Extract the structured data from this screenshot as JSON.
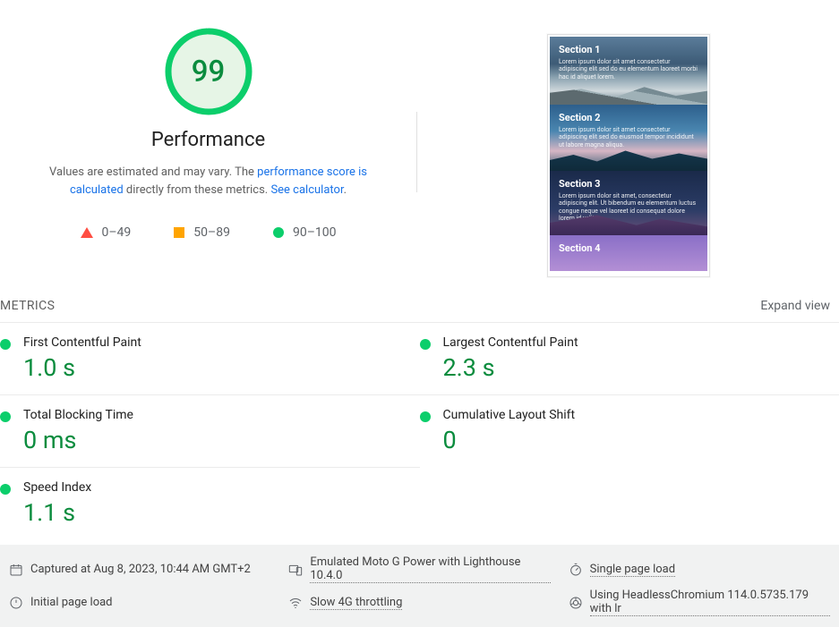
{
  "score": {
    "value": "99",
    "percent": 99,
    "title": "Performance",
    "desc_prefix": "Values are estimated and may vary. The ",
    "link1_text": "performance score is calculated",
    "desc_middle": " directly from these metrics. ",
    "link2_text": "See calculator"
  },
  "legend": {
    "fail": "0–49",
    "avg": "50–89",
    "pass": "90–100"
  },
  "preview_sections": [
    {
      "title": "Section 1",
      "body": "Lorem ipsum dolor sit amet consectetur adipiscing elit sed do eu elementum laoreet morbi hac id aliquet lorem."
    },
    {
      "title": "Section 2",
      "body": "Lorem ipsum dolor sit amet consectetur adipiscing elit sed do eiusmod tempor incididunt ut labore magna aliqua."
    },
    {
      "title": "Section 3",
      "body": "Lorem ipsum dolor sit amet, consectetur adipiscing elit. Ut bibendum eu elementum luctus congue neque vel laoreet id consequat dolore lorem id velit."
    },
    {
      "title": "Section 4",
      "body": ""
    }
  ],
  "metrics_header": {
    "title": "METRICS",
    "expand": "Expand view"
  },
  "metrics": [
    {
      "label": "First Contentful Paint",
      "value": "1.0 s",
      "status": "pass"
    },
    {
      "label": "Largest Contentful Paint",
      "value": "2.3 s",
      "status": "pass"
    },
    {
      "label": "Total Blocking Time",
      "value": "0 ms",
      "status": "pass"
    },
    {
      "label": "Cumulative Layout Shift",
      "value": "0",
      "status": "pass"
    },
    {
      "label": "Speed Index",
      "value": "1.1 s",
      "status": "pass"
    }
  ],
  "footer": {
    "captured": "Captured at Aug 8, 2023, 10:44 AM GMT+2",
    "emulated": "Emulated Moto G Power with Lighthouse 10.4.0",
    "single": "Single page load",
    "initial": "Initial page load",
    "throttle": "Slow 4G throttling",
    "headless": "Using HeadlessChromium 114.0.5735.179 with lr"
  }
}
